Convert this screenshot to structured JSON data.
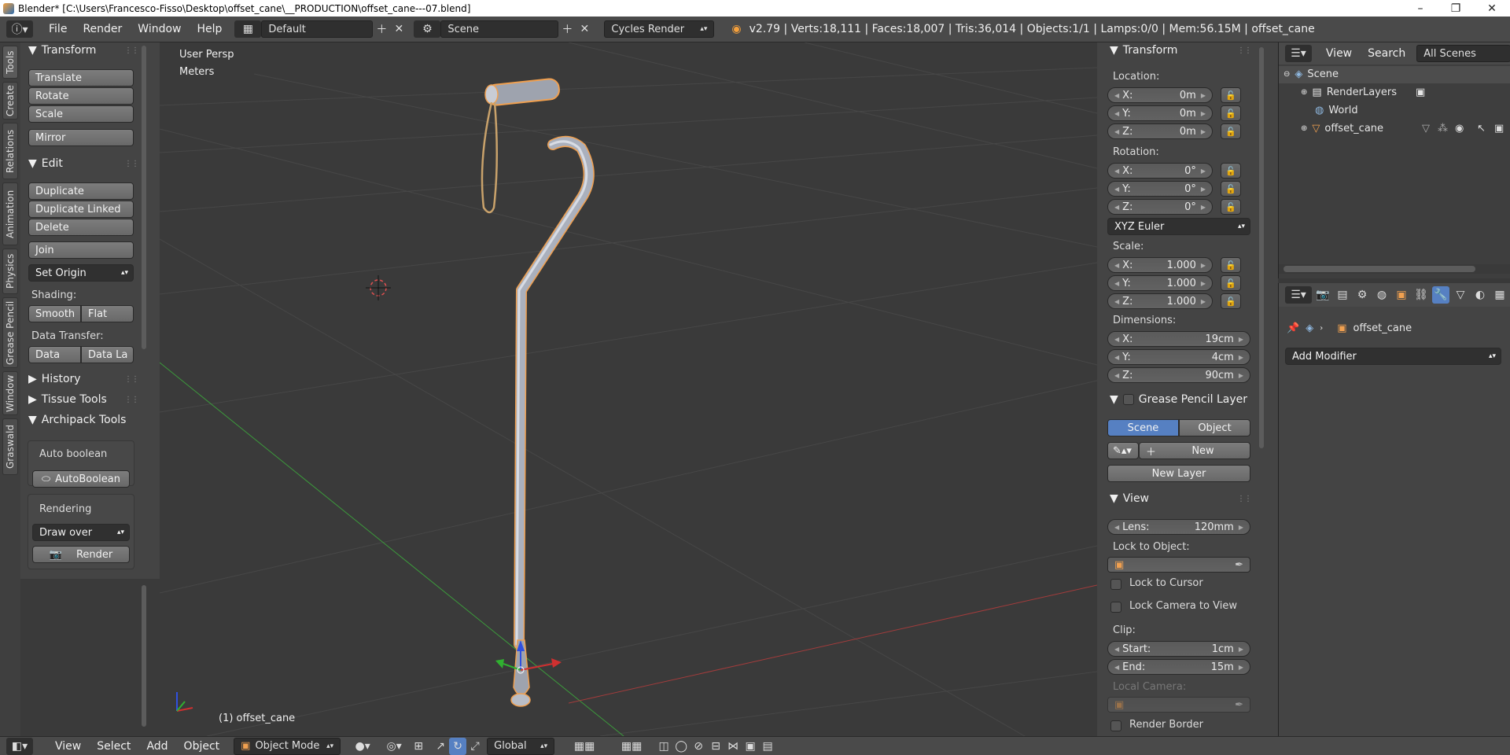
{
  "window": {
    "title": "Blender* [C:\\Users\\Francesco-Fisso\\Desktop\\offset_cane\\__PRODUCTION\\offset_cane---07.blend]",
    "controls": [
      "–",
      "❐",
      "✕"
    ]
  },
  "topbar": {
    "menus": [
      "File",
      "Render",
      "Window",
      "Help"
    ],
    "layout": "Default",
    "scene": "Scene",
    "engine": "Cycles Render",
    "stats": "v2.79 | Verts:18,111 | Faces:18,007 | Tris:36,014 | Objects:1/1 | Lamps:0/0 | Mem:56.15M | offset_cane"
  },
  "left_tabs": [
    "Tools",
    "Create",
    "Relations",
    "Animation",
    "Physics",
    "Grease Pencil",
    "Window",
    "Graswald"
  ],
  "tools": {
    "transform_header": "Transform",
    "translate": "Translate",
    "rotate": "Rotate",
    "scale": "Scale",
    "mirror": "Mirror",
    "edit_header": "Edit",
    "duplicate": "Duplicate",
    "duplicate_linked": "Duplicate Linked",
    "delete": "Delete",
    "join": "Join",
    "set_origin": "Set Origin",
    "shading_label": "Shading:",
    "smooth": "Smooth",
    "flat": "Flat",
    "data_transfer_label": "Data Transfer:",
    "data": "Data",
    "data_la": "Data La",
    "history": "History",
    "tissue_tools": "Tissue Tools",
    "archipack_tools": "Archipack Tools",
    "auto_boolean_label": "Auto boolean",
    "auto_boolean_btn": "AutoBoolean",
    "rendering_label": "Rendering",
    "draw_over": "Draw over",
    "render": "Render"
  },
  "viewport": {
    "view_name": "User Persp",
    "units": "Meters",
    "object_label": "(1) offset_cane"
  },
  "properties_panel": {
    "transform_header": "Transform",
    "location_label": "Location:",
    "location": [
      {
        "axis": "X:",
        "value": "0m"
      },
      {
        "axis": "Y:",
        "value": "0m"
      },
      {
        "axis": "Z:",
        "value": "0m"
      }
    ],
    "rotation_label": "Rotation:",
    "rotation": [
      {
        "axis": "X:",
        "value": "0°"
      },
      {
        "axis": "Y:",
        "value": "0°"
      },
      {
        "axis": "Z:",
        "value": "0°"
      }
    ],
    "rotation_mode": "XYZ Euler",
    "scale_label": "Scale:",
    "scale": [
      {
        "axis": "X:",
        "value": "1.000"
      },
      {
        "axis": "Y:",
        "value": "1.000"
      },
      {
        "axis": "Z:",
        "value": "1.000"
      }
    ],
    "dimensions_label": "Dimensions:",
    "dimensions": [
      {
        "axis": "X:",
        "value": "19cm"
      },
      {
        "axis": "Y:",
        "value": "4cm"
      },
      {
        "axis": "Z:",
        "value": "90cm"
      }
    ],
    "grease_pencil_header": "Grease Pencil Layer",
    "gp_scene": "Scene",
    "gp_object": "Object",
    "gp_new": "New",
    "gp_new_layer": "New Layer",
    "view_header": "View",
    "lens_label": "Lens:",
    "lens_value": "120mm",
    "lock_to_object": "Lock to Object:",
    "lock_to_cursor": "Lock to Cursor",
    "lock_camera": "Lock Camera to View",
    "clip_label": "Clip:",
    "clip_start_label": "Start:",
    "clip_start": "1cm",
    "clip_end_label": "End:",
    "clip_end": "15m",
    "local_camera": "Local Camera:",
    "render_border": "Render Border"
  },
  "outliner": {
    "view": "View",
    "search": "Search",
    "all_scenes": "All Scenes",
    "items": [
      "Scene",
      "RenderLayers",
      "World",
      "offset_cane"
    ]
  },
  "properties_editor": {
    "object_name": "offset_cane",
    "add_modifier": "Add Modifier"
  },
  "bottombar": {
    "menus": [
      "View",
      "Select",
      "Add",
      "Object"
    ],
    "mode": "Object Mode",
    "orientation": "Global"
  },
  "colors": {
    "background": "#393939",
    "panel": "#4a4a4a",
    "accent_blue": "#5680c2",
    "selection_orange": "#f0a050"
  }
}
